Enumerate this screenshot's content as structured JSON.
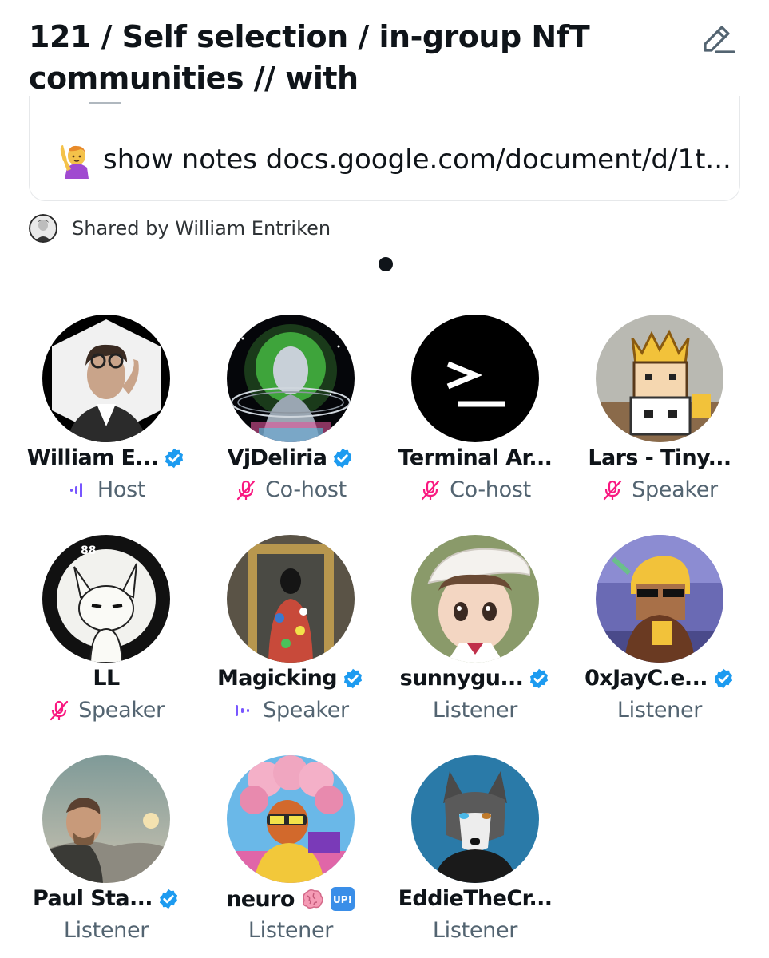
{
  "space": {
    "title_line1": "121 / Self selection / in-group NfT",
    "title_line2": "communities // with",
    "description": "show notes docs.google.com/document/d/1t...",
    "shared_by": "Shared by William Entriken"
  },
  "colors": {
    "verified": "#1d9bf0",
    "speaking": "#7856ff",
    "muted": "#f91880",
    "text_primary": "#0f1419",
    "text_secondary": "#536471"
  },
  "participants": [
    {
      "name": "William E...",
      "verified": true,
      "role": "Host",
      "role_icon": "speaking-icon"
    },
    {
      "name": "VjDeliria",
      "verified": true,
      "role": "Co-host",
      "role_icon": "mic-muted-icon"
    },
    {
      "name": "Terminal Ar...",
      "verified": false,
      "role": "Co-host",
      "role_icon": "mic-muted-icon"
    },
    {
      "name": "Lars - Tiny...",
      "verified": false,
      "role": "Speaker",
      "role_icon": "mic-muted-icon"
    },
    {
      "name": "LL",
      "verified": false,
      "role": "Speaker",
      "role_icon": "mic-muted-icon"
    },
    {
      "name": "Magicking",
      "verified": true,
      "role": "Speaker",
      "role_icon": "speaking-icon"
    },
    {
      "name": "sunnygu...",
      "verified": true,
      "role": "Listener",
      "role_icon": ""
    },
    {
      "name": "0xJayC.e...",
      "verified": true,
      "role": "Listener",
      "role_icon": ""
    },
    {
      "name": "Paul Sta...",
      "verified": true,
      "role": "Listener",
      "role_icon": ""
    },
    {
      "name": "neuro",
      "verified": false,
      "name_emojis": [
        "brain-emoji",
        "up-button-emoji"
      ],
      "role": "Listener",
      "role_icon": ""
    },
    {
      "name": "EddieTheCr...",
      "verified": false,
      "role": "Listener",
      "role_icon": ""
    }
  ]
}
